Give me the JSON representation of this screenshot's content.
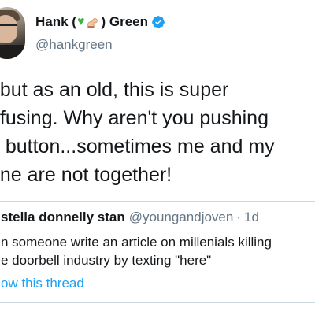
{
  "author": {
    "name_prefix": "Hank (",
    "name_suffix": ") Green",
    "name_emojis": [
      "green-heart-emoji",
      "flexed-arm-emoji"
    ],
    "verified": true,
    "handle": "@hankgreen"
  },
  "tweet": {
    "lines": [
      ", but as an old, this is super",
      "nfusing. Why aren't you pushing",
      "e button...sometimes me and my",
      "one are not together!"
    ]
  },
  "quoted_tweet": {
    "name": "stella donnelly stan",
    "handle": "@youngandjoven",
    "separator": "·",
    "time": "1d",
    "lines": [
      "n someone write an article on millenials killing",
      "e doorbell industry by texting \"here\""
    ],
    "show_thread": "ow this thread"
  },
  "colors": {
    "text": "#14171a",
    "secondary": "#657786",
    "link": "#1da1f2",
    "verified": "#1da1f2",
    "heart": "#43b047",
    "border": "#ccd6dd"
  }
}
